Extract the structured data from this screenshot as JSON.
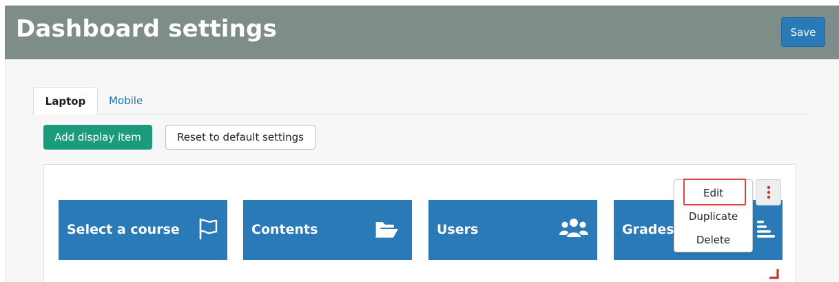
{
  "header": {
    "title": "Dashboard settings",
    "save_label": "Save"
  },
  "tabs": [
    {
      "label": "Laptop",
      "active": true
    },
    {
      "label": "Mobile",
      "active": false
    }
  ],
  "actions": {
    "add_label": "Add display item",
    "reset_label": "Reset to default settings"
  },
  "tiles": [
    {
      "label": "Select a course",
      "icon": "flag-icon"
    },
    {
      "label": "Contents",
      "icon": "folder-open-icon"
    },
    {
      "label": "Users",
      "icon": "users-icon"
    },
    {
      "label": "Grades",
      "icon": "align-left-icon"
    }
  ],
  "menu": {
    "items": [
      "Edit",
      "Duplicate",
      "Delete"
    ],
    "highlighted": "Edit"
  },
  "colors": {
    "header_bg": "#7f8d8a",
    "primary": "#2a7ab8",
    "success": "#1a9c7a",
    "highlight": "#e0423c",
    "link": "#1d6fb8"
  }
}
